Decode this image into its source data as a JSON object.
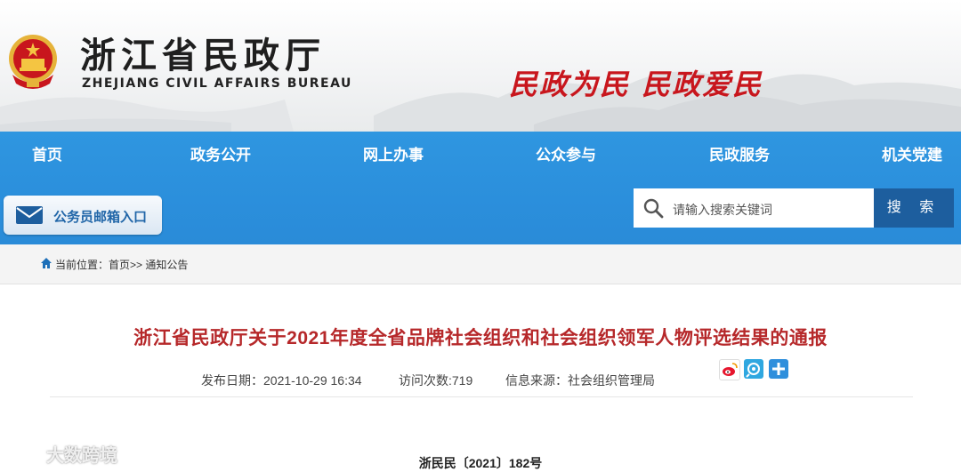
{
  "header": {
    "title": "浙江省民政厅",
    "subtitle": "ZHEJIANG CIVIL AFFAIRS BUREAU",
    "slogan": "民政为民  民政爱民",
    "brand_color": "#c8161d"
  },
  "nav": {
    "items": [
      {
        "label": "首页"
      },
      {
        "label": "政务公开"
      },
      {
        "label": "网上办事"
      },
      {
        "label": "公众参与"
      },
      {
        "label": "民政服务"
      },
      {
        "label": "机关党建"
      }
    ],
    "bg_color": "#2b8fdc"
  },
  "mailbox": {
    "label": "公务员邮箱入口",
    "icon": "envelope-icon"
  },
  "search": {
    "placeholder": "请输入搜索关键词",
    "button_label": "搜 索",
    "icon": "search-icon"
  },
  "breadcrumb": {
    "prefix": "当前位置：",
    "home": "首页",
    "separator": ">>",
    "current": "通知公告",
    "icon": "home-icon"
  },
  "article": {
    "title": "浙江省民政厅关于2021年度全省品牌社会组织和社会组织领军人物评选结果的通报",
    "publish_date": "发布日期：2021-10-29 16:34",
    "visits": "访问次数:719",
    "source": "信息来源：社会组织管理局",
    "share_icons": [
      "weibo-icon",
      "tencent-weibo-icon",
      "share-more-icon"
    ],
    "doc_number": "浙民民〔2021〕182号",
    "title_color": "#b6282a"
  },
  "watermark": {
    "text": "大数跨境"
  }
}
